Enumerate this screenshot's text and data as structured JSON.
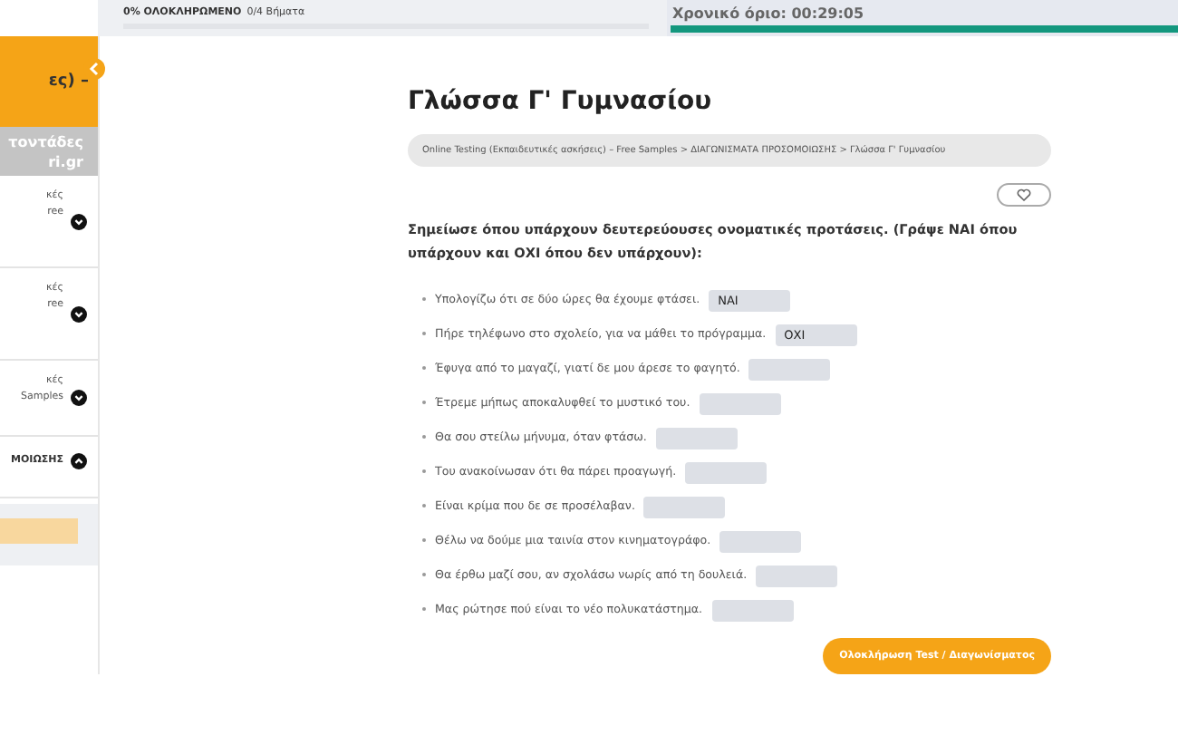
{
  "progress": {
    "label": "0% ΟΛΟΚΛΗΡΩΜΕΝΟ",
    "steps": "0/4 Βήματα",
    "level": 0
  },
  "timer": {
    "label": "Χρονικό όριο: 00:29:05",
    "level": 1
  },
  "sidebar": {
    "title": "ες) –",
    "subtitle": [
      "τοντάδες",
      "ri.gr"
    ],
    "items": [
      {
        "lines": [
          "κές",
          "ree"
        ],
        "expanded": false
      },
      {
        "lines": [
          "κές",
          "ree"
        ],
        "expanded": false
      },
      {
        "lines": [
          "κές",
          "Samples"
        ],
        "expanded": false
      },
      {
        "lines": [
          "ΜΟΙΩΣΗΣ"
        ],
        "expanded": true
      }
    ]
  },
  "page": {
    "title": "Γλώσσα Γ' Γυμνασίου",
    "breadcrumb": "Online Testing (Εκπαιδευτικές ασκήσεις) – Free Samples > ΔΙΑΓΩΝΙΣΜΑΤΑ ΠΡΟΣΟΜΟΙΩΣΗΣ > Γλώσσα Γ' Γυμνασίου",
    "instruction": "Σημείωσε  όπου υπάρχουν δευτερεύουσες ονοματικές προτάσεις. (Γράψε ΝΑΙ όπου υπάρχουν και ΟΧΙ όπου δεν υπάρχουν):",
    "questions": [
      {
        "text": "Υπολογίζω ότι σε δύο ώρες θα έχουμε φτάσει.",
        "answer": "ΝΑΙ"
      },
      {
        "text": "Πήρε τηλέφωνο στο σχολείο, για να μάθει το πρόγραμμα.",
        "answer": "ΟΧΙ"
      },
      {
        "text": "Έφυγα από το μαγαζί, γιατί δε μου άρεσε το φαγητό."
      },
      {
        "text": "Έτρεμε μήπως αποκαλυφθεί το μυστικό του."
      },
      {
        "text": "Θα σου στείλω μήνυμα, όταν φτάσω."
      },
      {
        "text": "Του ανακοίνωσαν ότι θα πάρει προαγωγή."
      },
      {
        "text": "Είναι κρίμα που δε σε προσέλαβαν."
      },
      {
        "text": "Θέλω να δούμε μια ταινία στον κινηματογράφο."
      },
      {
        "text": "Θα έρθω μαζί σου, αν σχολάσω νωρίς από τη δουλειά."
      },
      {
        "text": "Μας ρώτησε πού είναι το νέο πολυκατάστημα."
      }
    ],
    "finish_button": "Ολοκλήρωση Test / Διαγωνίσματος"
  }
}
